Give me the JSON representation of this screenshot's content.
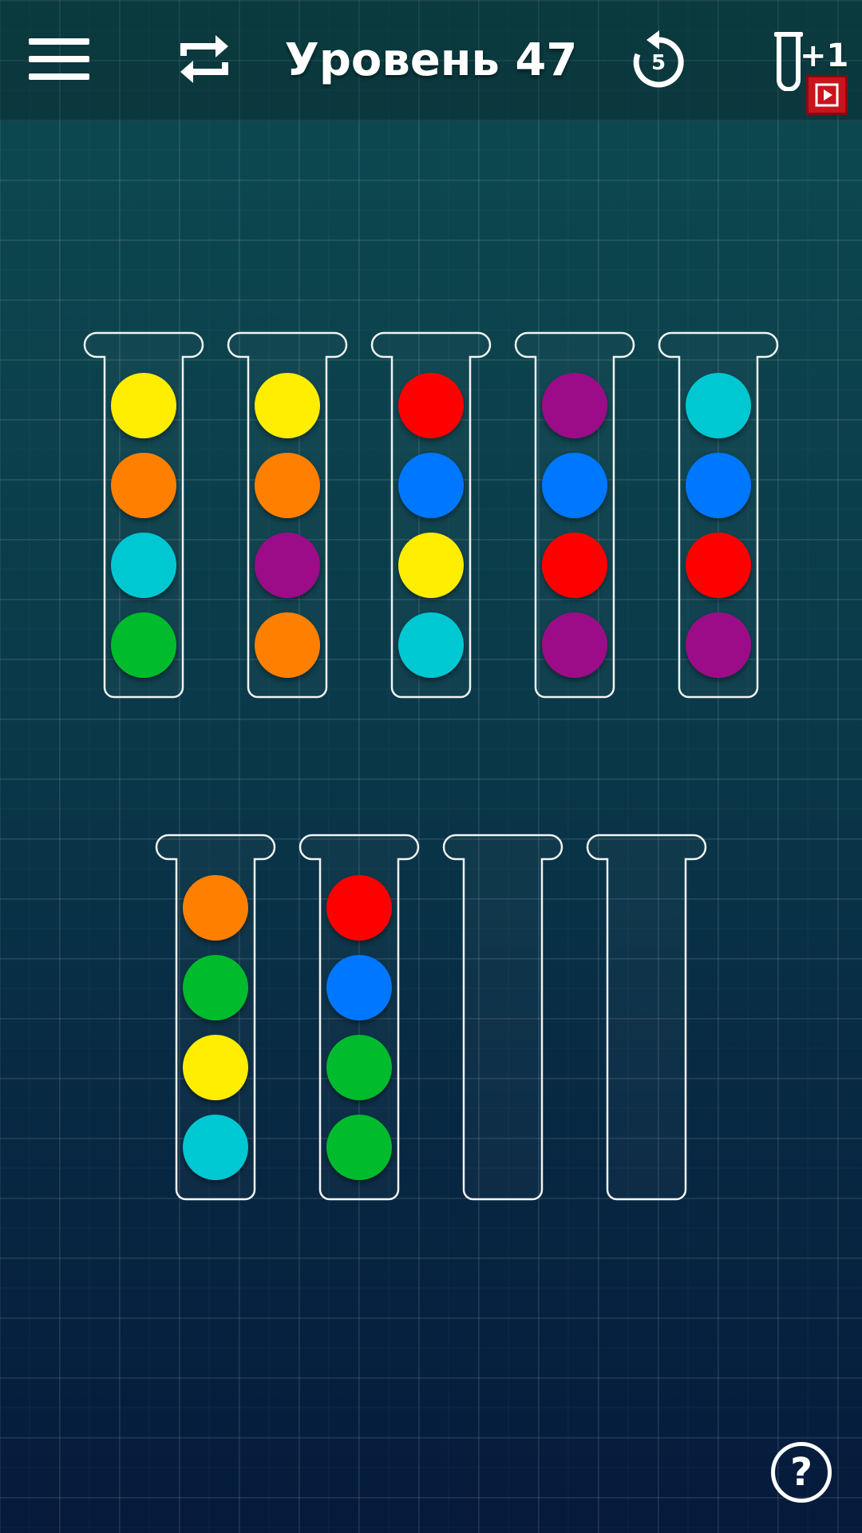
{
  "header": {
    "title": "Уровень 47",
    "restart_count": "5",
    "add_tube_label": "+1",
    "icons": {
      "menu": "menu-icon",
      "reshuffle": "repeat-arrows-icon",
      "restart": "restart-icon",
      "add_tube": "test-tube-icon",
      "video": "play-video-icon"
    }
  },
  "colors": {
    "yellow": "#ffee00",
    "orange": "#ff8000",
    "cyan": "#00c8d2",
    "green": "#00bb2c",
    "purple": "#9c0c88",
    "red": "#ff0000",
    "blue": "#0077ff"
  },
  "tubes": [
    {
      "row": 0,
      "balls": [
        "yellow",
        "orange",
        "cyan",
        "green"
      ]
    },
    {
      "row": 0,
      "balls": [
        "yellow",
        "orange",
        "purple",
        "orange"
      ]
    },
    {
      "row": 0,
      "balls": [
        "red",
        "blue",
        "yellow",
        "cyan"
      ]
    },
    {
      "row": 0,
      "balls": [
        "purple",
        "blue",
        "red",
        "purple"
      ]
    },
    {
      "row": 0,
      "balls": [
        "cyan",
        "blue",
        "red",
        "purple"
      ]
    },
    {
      "row": 1,
      "balls": [
        "orange",
        "green",
        "yellow",
        "cyan"
      ]
    },
    {
      "row": 1,
      "balls": [
        "red",
        "blue",
        "green",
        "green"
      ]
    },
    {
      "row": 1,
      "balls": []
    },
    {
      "row": 1,
      "balls": []
    }
  ],
  "help": {
    "label": "?",
    "icon": "help-icon"
  }
}
